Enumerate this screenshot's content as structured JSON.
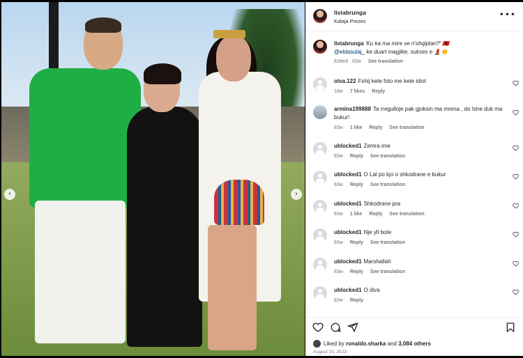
{
  "post": {
    "username": "liviabrunga",
    "location": "Kalaja Prezes",
    "more_icon": "more-horizontal-icon"
  },
  "caption": {
    "username": "liviabrunga",
    "text_1": "'Ku ka ma mire se n'shqiptari?' 🇦🇱",
    "mention": "@eldasulaj_",
    "text_2": "ke duart magjike, sukses e 💄👏",
    "edited": "Edited · 83w",
    "see_translation": "See translation"
  },
  "comments": [
    {
      "username": "olsa.122",
      "text": "Fshij kete foto me kete idiot",
      "time": "18w",
      "likes": "7 likes",
      "reply": "Reply",
      "translation": ""
    },
    {
      "username": "armina199888",
      "text": "Ta rregulloje pak gjoksin ma mrena , do Ishe duk ma bukur!",
      "time": "83w",
      "likes": "1 like",
      "reply": "Reply",
      "translation": "See translation"
    },
    {
      "username": "ublocked1",
      "text": "Zemra ime",
      "time": "83w",
      "likes": "",
      "reply": "Reply",
      "translation": "See translation"
    },
    {
      "username": "ublocked1",
      "text": "O Lal po kjo o shkodrane e bukur",
      "time": "83w",
      "likes": "",
      "reply": "Reply",
      "translation": "See translation"
    },
    {
      "username": "ublocked1",
      "text": "Shkodrane pra",
      "time": "83w",
      "likes": "1 like",
      "reply": "Reply",
      "translation": "See translation"
    },
    {
      "username": "ublocked1",
      "text": "Nje yll bote",
      "time": "83w",
      "likes": "",
      "reply": "Reply",
      "translation": "See translation"
    },
    {
      "username": "ublocked1",
      "text": "Marshallah",
      "time": "83w",
      "likes": "",
      "reply": "Reply",
      "translation": "See translation"
    },
    {
      "username": "ublocked1",
      "text": "O diva",
      "time": "83w",
      "likes": "",
      "reply": "Reply",
      "translation": ""
    }
  ],
  "actions": {
    "liked_by_prefix": "Liked by",
    "liked_by_user": "ronaldo.sharka",
    "liked_by_and": "and",
    "liked_by_count": "3,084 others",
    "date": "August 10, 2023"
  },
  "icons": {
    "like": "heart-icon",
    "comment": "comment-icon",
    "share": "share-icon",
    "save": "bookmark-icon",
    "prev": "chevron-left-icon",
    "next": "chevron-right-icon"
  }
}
